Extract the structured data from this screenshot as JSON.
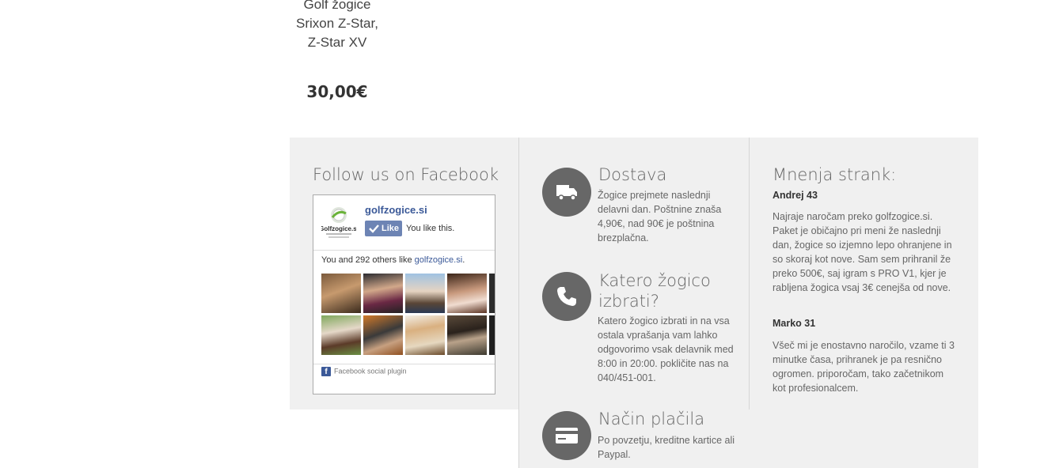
{
  "product": {
    "title": "Golf žogice Srixon Z-Star, Z-Star XV",
    "price": "30,00€"
  },
  "facebook": {
    "heading": "Follow us on Facebook",
    "page_name": "golfzogice.si",
    "logo_text": "Golfzogice.si",
    "like_label": "Like",
    "you_like": "You like this.",
    "count_prefix": "You and 292 others like ",
    "count_link": "golfzogice.si",
    "count_suffix": ".",
    "plugin_label": "Facebook social plugin"
  },
  "features": [
    {
      "title": "Dostava",
      "icon": "truck-icon",
      "text": "Žogice prejmete naslednji delavni dan. Poštnine znaša 4,90€, nad 90€ je poštnina brezplačna."
    },
    {
      "title": "Katero žogico izbrati?",
      "icon": "phone-icon",
      "text": "Katero žogico izbrati in na vsa ostala vprašanja vam lahko odgovorimo vsak delavnik med 8:00 in 20:00. pokličite nas na 040/451-001."
    },
    {
      "title": "Način plačila",
      "icon": "credit-card-icon",
      "text": "Po povzetju, kreditne kartice ali Paypal."
    }
  ],
  "reviews": {
    "heading": "Mnenja strank:",
    "items": [
      {
        "name": "Andrej 43",
        "text": "Najraje naročam preko golfzogice.si. Paket je običajno pri meni že naslednji dan, žogice so izjemno lepo ohranjene in so skoraj kot nove. Sam sem prihranil že preko 500€, saj igram s PRO V1, kjer je rabljena žogica vsaj 3€ cenejša od nove."
      },
      {
        "name": "Marko 31",
        "text": "Všeč mi je enostavno naročilo, vzame ti 3 minutke časa, prihranek je pa resnično ogromen. priporočam, tako začetnikom kot profesionalcem."
      }
    ]
  },
  "colors": {
    "footer_bg": "#f0f0f0",
    "icon_circle": "#676767",
    "fb_blue": "#3b5998"
  }
}
